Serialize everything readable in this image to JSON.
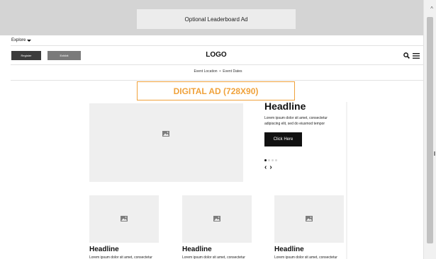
{
  "ads": {
    "leaderboard_label": "Optional Leaderboard Ad",
    "digital_label": "DIGITAL AD (728X90)",
    "digital_color": "#f0a23b"
  },
  "nav": {
    "explore_label": "Explore"
  },
  "header": {
    "register_label": "Register",
    "exhibit_label": "Exhibit",
    "logo_text": "LOGO",
    "search_icon": "search-icon",
    "menu_icon": "hamburger-menu-icon"
  },
  "event": {
    "location": "Event Location",
    "separator": "•",
    "dates": "Event Dates"
  },
  "hero": {
    "headline": "Headline",
    "body": "Lorem ipsum dolor sit amet, consectetur adipiscing elit, sed do eiusmod tempor",
    "button_label": "Click Here",
    "slide_count": 4,
    "active_slide": 1,
    "prev_arrow": "‹",
    "next_arrow": "›"
  },
  "cards": [
    {
      "headline": "Headline",
      "body": "Lorem ipsum dolor sit amet, consectetur"
    },
    {
      "headline": "Headline",
      "body": "Lorem ipsum dolor sit amet, consectetur"
    },
    {
      "headline": "Headline",
      "body": "Lorem ipsum dolor sit amet, consectetur"
    }
  ]
}
